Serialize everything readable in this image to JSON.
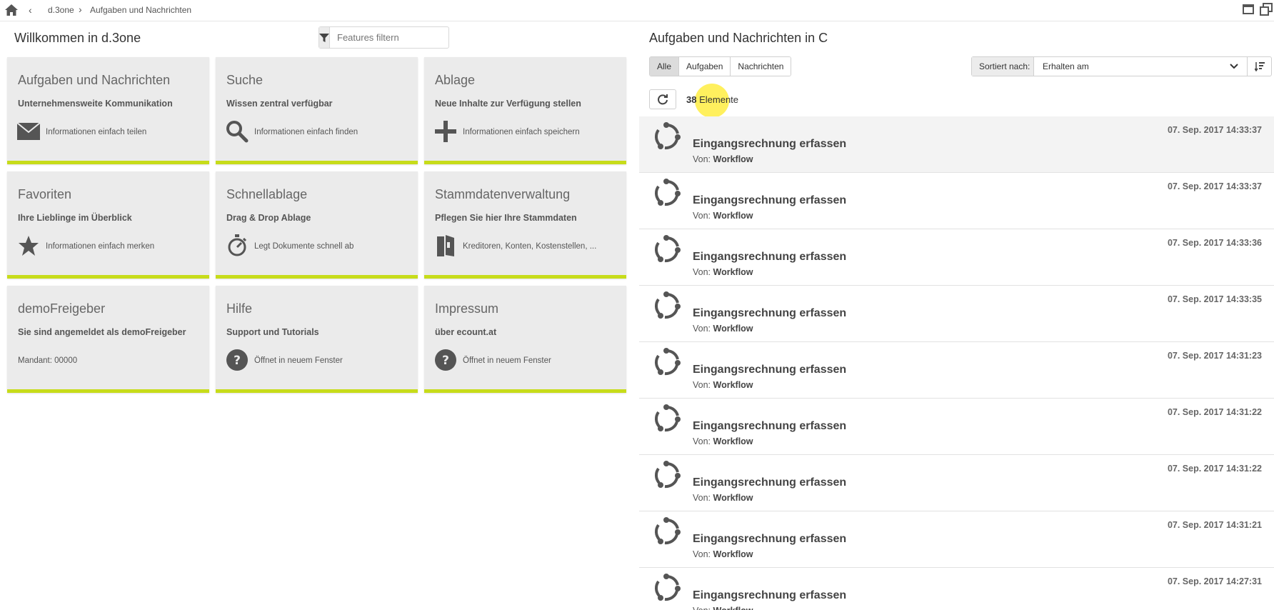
{
  "breadcrumb": {
    "back": "‹",
    "item1": "d.3one",
    "separator": "›",
    "item2": "Aufgaben und Nachrichten"
  },
  "left": {
    "title": "Willkommen in d.3one",
    "filter_placeholder": "Features filtern",
    "tiles": [
      {
        "title": "Aufgaben und Nachrichten",
        "subtitle": "Unternehmensweite Kommunikation",
        "text": "Informationen einfach teilen",
        "icon": "mail-icon"
      },
      {
        "title": "Suche",
        "subtitle": "Wissen zentral verfügbar",
        "text": "Informationen einfach finden",
        "icon": "search-icon"
      },
      {
        "title": "Ablage",
        "subtitle": "Neue Inhalte zur Verfügung stellen",
        "text": "Informationen einfach speichern",
        "icon": "plus-icon"
      },
      {
        "title": "Favoriten",
        "subtitle": "Ihre Lieblinge im Überblick",
        "text": "Informationen einfach merken",
        "icon": "star-icon"
      },
      {
        "title": "Schnellablage",
        "subtitle": "Drag & Drop Ablage",
        "text": "Legt Dokumente schnell ab",
        "icon": "stopwatch-icon"
      },
      {
        "title": "Stammdatenverwaltung",
        "subtitle": "Pflegen Sie hier Ihre Stammdaten",
        "text": "Kreditoren, Konten, Kostenstellen, ...",
        "icon": "binder-icon"
      },
      {
        "title": "demoFreigeber",
        "subtitle": "Sie sind angemeldet als demoFreigeber",
        "text": "Mandant: 00000",
        "icon": ""
      },
      {
        "title": "Hilfe",
        "subtitle": "Support und Tutorials",
        "text": "Öffnet in neuem Fenster",
        "icon": "help-icon"
      },
      {
        "title": "Impressum",
        "subtitle": "über ecount.at",
        "text": "Öffnet in neuem Fenster",
        "icon": "help-icon"
      }
    ]
  },
  "right": {
    "title": "Aufgaben und Nachrichten in C",
    "tabs": [
      "Alle",
      "Aufgaben",
      "Nachrichten"
    ],
    "active_tab": "Alle",
    "sort_label": "Sortiert nach:",
    "sort_value": "Erhalten am",
    "count_number": "38",
    "count_label": "Elemente",
    "from_label": "Von:",
    "items": [
      {
        "title": "Eingangsrechnung erfassen",
        "from": "Workflow",
        "date": "07. Sep. 2017 14:33:37"
      },
      {
        "title": "Eingangsrechnung erfassen",
        "from": "Workflow",
        "date": "07. Sep. 2017 14:33:37"
      },
      {
        "title": "Eingangsrechnung erfassen",
        "from": "Workflow",
        "date": "07. Sep. 2017 14:33:36"
      },
      {
        "title": "Eingangsrechnung erfassen",
        "from": "Workflow",
        "date": "07. Sep. 2017 14:33:35"
      },
      {
        "title": "Eingangsrechnung erfassen",
        "from": "Workflow",
        "date": "07. Sep. 2017 14:31:23"
      },
      {
        "title": "Eingangsrechnung erfassen",
        "from": "Workflow",
        "date": "07. Sep. 2017 14:31:22"
      },
      {
        "title": "Eingangsrechnung erfassen",
        "from": "Workflow",
        "date": "07. Sep. 2017 14:31:22"
      },
      {
        "title": "Eingangsrechnung erfassen",
        "from": "Workflow",
        "date": "07. Sep. 2017 14:31:21"
      },
      {
        "title": "Eingangsrechnung erfassen",
        "from": "Workflow",
        "date": "07. Sep. 2017 14:27:31"
      }
    ]
  },
  "colors": {
    "accent": "#c7dc1a",
    "tile_bg": "#ebebeb",
    "cursor_highlight": "#ffeb28"
  }
}
